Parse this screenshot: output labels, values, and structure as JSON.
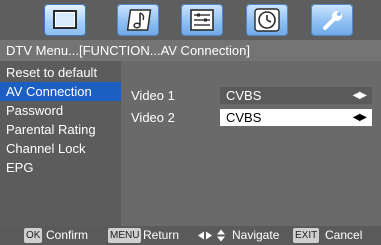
{
  "icons": [
    "tv-picture-icon",
    "music-note-icon",
    "setup-panel-icon",
    "clock-icon",
    "tools-icon"
  ],
  "breadcrumb": "DTV Menu...[FUNCTION...AV Connection]",
  "menu": {
    "items": [
      {
        "label": "Reset to default",
        "selected": false
      },
      {
        "label": "AV Connection",
        "selected": true
      },
      {
        "label": "Password",
        "selected": false
      },
      {
        "label": "Parental Rating",
        "selected": false
      },
      {
        "label": "Channel Lock",
        "selected": false
      },
      {
        "label": "EPG",
        "selected": false
      }
    ]
  },
  "settings": [
    {
      "label": "Video 1",
      "value": "CVBS",
      "arrows": "◀▶"
    },
    {
      "label": "Video 2",
      "value": "CVBS",
      "arrows": "◀▶"
    }
  ],
  "help": {
    "ok_key": "OK",
    "ok_label": "Confirm",
    "menu_key": "MENU",
    "menu_label": "Return",
    "nav_label": "Navigate",
    "exit_key": "EXIT",
    "exit_label": "Cancel"
  },
  "colors": {
    "selected": "#1b5fc3",
    "panel": "#5a5a5a"
  }
}
